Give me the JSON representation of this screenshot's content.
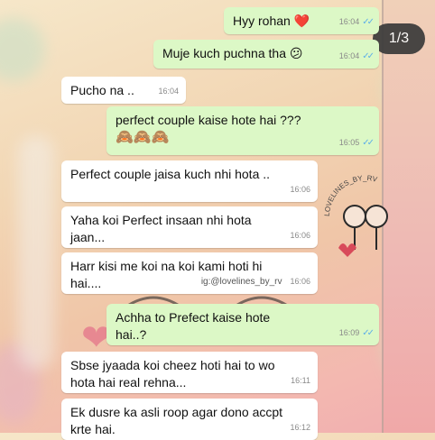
{
  "pager": {
    "label": "1/3"
  },
  "messages": [
    {
      "text": "Hyy rohan",
      "time": "16:04",
      "emoji": "❤️"
    },
    {
      "text": "Muje kuch puchna tha",
      "time": "16:04",
      "emoji": "😕"
    },
    {
      "text": "Pucho na ..",
      "time": "16:04"
    },
    {
      "text": "perfect couple kaise hote hai ???",
      "emoji": "🙈🙈🙈",
      "time": "16:05"
    },
    {
      "text": "Perfect couple jaisa kuch nhi hota ..",
      "time": "16:06"
    },
    {
      "text": "Yaha koi Perfect insaan nhi hota jaan...",
      "time": "16:06"
    },
    {
      "text": "Harr kisi me koi na koi kami hoti hi hai....",
      "watermark": "ig:@lovelines_by_rv",
      "time": "16:06"
    },
    {
      "text": "Achha to Prefect kaise hote hai..?",
      "time": "16:09"
    },
    {
      "text": "Sbse jyaada koi cheez hoti hai to wo hota hai real rehna...",
      "time": "16:11"
    },
    {
      "text": "Ek dusre ka asli roop agar dono accpt krte hai.",
      "time": "16:12"
    }
  ],
  "sticker": {
    "text": "LOVELINES_BY_RV"
  },
  "colors": {
    "incoming": "#ffffff",
    "outgoing": "#dcf8c6",
    "ticks": "#5fb0e8"
  }
}
